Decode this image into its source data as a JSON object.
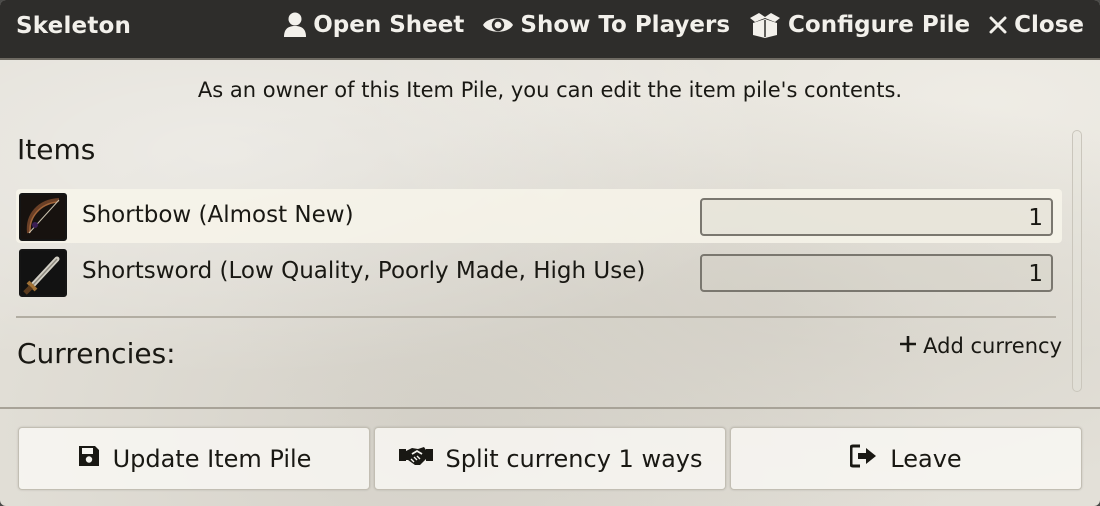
{
  "header": {
    "title": "Skeleton",
    "open_sheet": "Open Sheet",
    "show_to_players": "Show To Players",
    "configure_pile": "Configure Pile",
    "close": "Close"
  },
  "notice": "As an owner of this Item Pile, you can edit the item pile's contents.",
  "items_section": {
    "title": "Items",
    "rows": [
      {
        "name": "Shortbow (Almost New)",
        "quantity": "1",
        "icon": "shortbow-icon"
      },
      {
        "name": "Shortsword (Low Quality, Poorly Made, High Use)",
        "quantity": "1",
        "icon": "shortsword-icon"
      }
    ]
  },
  "currencies_section": {
    "title": "Currencies:",
    "add_label": "Add currency"
  },
  "footer": {
    "update_label": "Update Item Pile",
    "split_label": "Split currency 1 ways",
    "leave_label": "Leave"
  },
  "colors": {
    "header_bg": "#2e2d2b",
    "header_text": "#f2f0eb",
    "body_text": "#191813",
    "row_highlight": "#f7f4ea"
  }
}
